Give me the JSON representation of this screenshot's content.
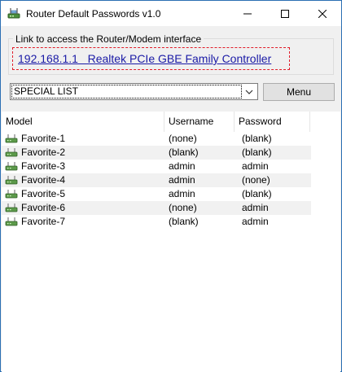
{
  "window": {
    "title": "Router Default Passwords v1.0",
    "icon": "router-app-icon"
  },
  "link_group": {
    "label": "Link to access the Router/Modem interface",
    "link_text": "192.168.1.1   Realtek PCIe GBE Family Controller",
    "link_color": "#1a1aa6",
    "focus_border_color": "#e11d2a"
  },
  "list_select": {
    "value": "SPECIAL LIST"
  },
  "menu_button": {
    "label": "Menu"
  },
  "table": {
    "columns": [
      "Model",
      "Username",
      "Password"
    ],
    "rows": [
      {
        "model": "Favorite-1",
        "username": "(none)",
        "password": "(blank)"
      },
      {
        "model": "Favorite-2",
        "username": "(blank)",
        "password": "(blank)"
      },
      {
        "model": "Favorite-3",
        "username": "admin",
        "password": "admin"
      },
      {
        "model": "Favorite-4",
        "username": "admin",
        "password": "(none)"
      },
      {
        "model": "Favorite-5",
        "username": "admin",
        "password": "(blank)"
      },
      {
        "model": "Favorite-6",
        "username": "(none)",
        "password": "admin"
      },
      {
        "model": "Favorite-7",
        "username": "(blank)",
        "password": "admin"
      }
    ],
    "row_icon": "router-device-icon"
  }
}
